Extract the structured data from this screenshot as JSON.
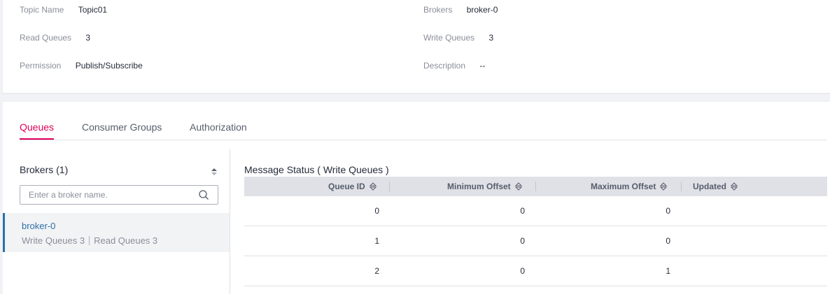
{
  "topic_info": {
    "topic_name_label": "Topic Name",
    "topic_name": "Topic01",
    "brokers_label": "Brokers",
    "brokers": "broker-0",
    "read_queues_label": "Read Queues",
    "read_queues": "3",
    "write_queues_label": "Write Queues",
    "write_queues": "3",
    "permission_label": "Permission",
    "permission": "Publish/Subscribe",
    "description_label": "Description",
    "description": "--"
  },
  "tabs": [
    {
      "label": "Queues",
      "active": true
    },
    {
      "label": "Consumer Groups",
      "active": false
    },
    {
      "label": "Authorization",
      "active": false
    }
  ],
  "sidebar": {
    "title": "Brokers (1)",
    "search_placeholder": "Enter a broker name.",
    "items": [
      {
        "name": "broker-0",
        "write_queues": "Write Queues 3",
        "read_queues": "Read Queues 3"
      }
    ]
  },
  "message_status": {
    "title": "Message Status ( Write Queues )",
    "columns": [
      "Queue ID",
      "Minimum Offset",
      "Maximum Offset",
      "Updated"
    ],
    "rows": [
      [
        "0",
        "0",
        "0",
        ""
      ],
      [
        "1",
        "0",
        "0",
        ""
      ],
      [
        "2",
        "0",
        "1",
        ""
      ]
    ]
  },
  "colors": {
    "accent": "#e0005c",
    "link": "#2d6fa6",
    "header_bg": "#dfe1e6"
  },
  "icons": {
    "sort": "sort-icon",
    "search": "search-icon"
  }
}
